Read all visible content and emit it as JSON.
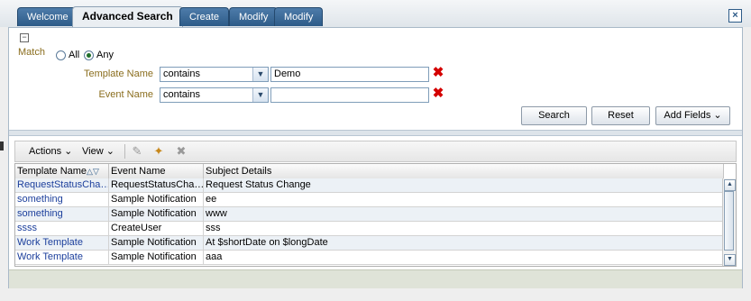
{
  "tabs": [
    {
      "label": "Welcome"
    },
    {
      "label": "Advanced Search"
    },
    {
      "label": "Create"
    },
    {
      "label": "Modify"
    },
    {
      "label": "Modify"
    }
  ],
  "close_icon": "close-icon",
  "search_panel": {
    "collapse_glyph": "−",
    "match_label": "Match",
    "match_options": [
      "All",
      "Any"
    ],
    "match_selected": "Any",
    "fields": [
      {
        "label": "Template Name",
        "operator": "contains",
        "value": "Demo"
      },
      {
        "label": "Event Name",
        "operator": "contains",
        "value": ""
      }
    ],
    "search_button": "Search",
    "reset_button": "Reset",
    "add_fields_button": "Add Fields"
  },
  "toolbar": {
    "actions_label": "Actions",
    "view_label": "View"
  },
  "table": {
    "columns": [
      "Template Name",
      "Event Name",
      "Subject Details"
    ],
    "rows": [
      {
        "template": "RequestStatusCha…",
        "event": "RequestStatusCha…",
        "subject": "Request Status Change"
      },
      {
        "template": "something",
        "event": "Sample Notification",
        "subject": "ee"
      },
      {
        "template": "something",
        "event": "Sample Notification",
        "subject": "www"
      },
      {
        "template": "ssss",
        "event": "CreateUser",
        "subject": "sss"
      },
      {
        "template": "Work Template",
        "event": "Sample Notification",
        "subject": "At $shortDate on $longDate"
      },
      {
        "template": "Work Template",
        "event": "Sample Notification",
        "subject": "aaa"
      }
    ]
  },
  "colors": {
    "tab_blue": "#3a6896",
    "label_gold": "#8a6d1d",
    "link_blue": "#1c3f9c",
    "delete_red": "#d40000"
  }
}
